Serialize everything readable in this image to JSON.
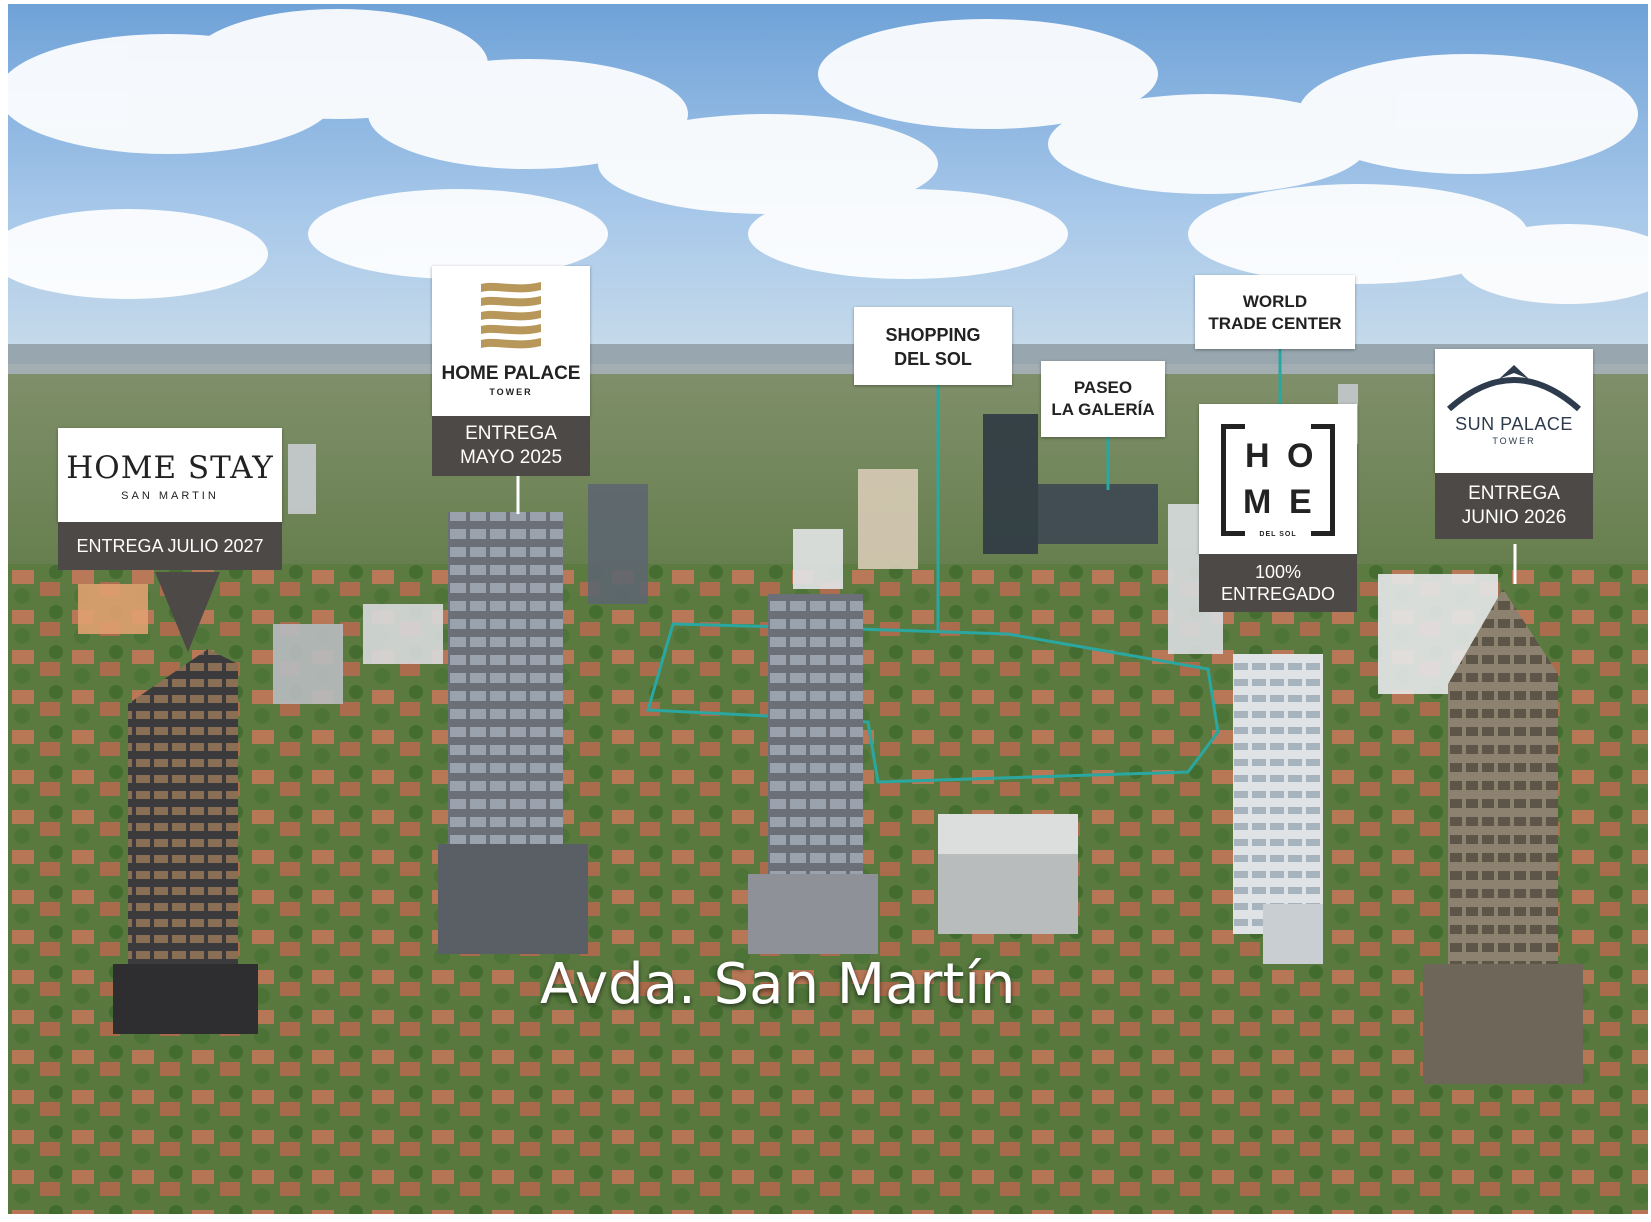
{
  "labels": {
    "home_stay": {
      "name": "HOME STAY",
      "sub": "SAN MARTIN",
      "delivery": "ENTREGA JULIO 2027"
    },
    "home_palace": {
      "name": "HOME PALACE",
      "sub": "TOWER",
      "delivery_line1": "ENTREGA",
      "delivery_line2": "MAYO 2025"
    },
    "shopping": {
      "line1": "SHOPPING",
      "line2": "DEL SOL"
    },
    "paseo": {
      "line1": "PASEO",
      "line2": "LA GALERÍA"
    },
    "wtc": {
      "line1": "WORLD",
      "line2": "TRADE CENTER"
    },
    "home_del_sol": {
      "letters": [
        "H",
        "O",
        "M",
        "E"
      ],
      "sub": "DEL SOL",
      "status_line1": "100%",
      "status_line2": "ENTREGADO"
    },
    "sun_palace": {
      "name": "SUN PALACE",
      "sub": "TOWER",
      "delivery_line1": "ENTREGA",
      "delivery_line2": "JUNIO 2026"
    }
  },
  "street_label": "Avda. San Martín",
  "colors": {
    "dark_tag": "#4d4946",
    "gold": "#b8985a",
    "outline": "#2aa7a0",
    "sky": "#8fb9e3"
  }
}
